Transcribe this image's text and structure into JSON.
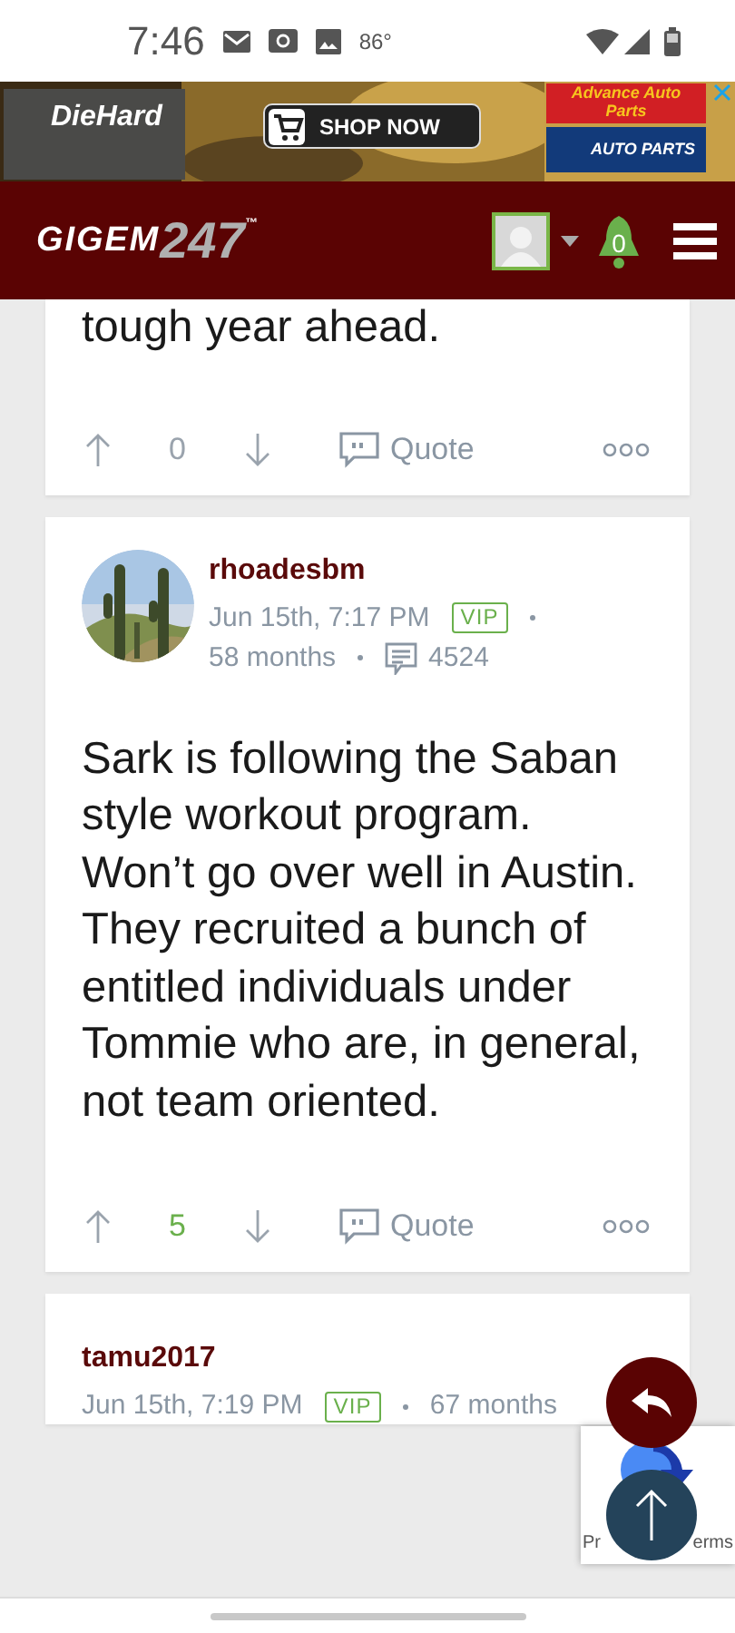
{
  "status_bar": {
    "time": "7:46",
    "temperature": "86°"
  },
  "ad": {
    "brand": "DieHard",
    "cta": "SHOP NOW",
    "retailer": "Advance Auto Parts",
    "partner": "AUTO PARTS"
  },
  "header": {
    "logo_main": "GIGEM",
    "logo_number": "247",
    "logo_mark": "™",
    "notifications": "0"
  },
  "posts": [
    {
      "body": "tough year ahead.",
      "votes": "0",
      "voted": false,
      "quote": "Quote"
    },
    {
      "author": "rhoadesbm",
      "avatar": true,
      "date": "Jun 15th, 7:17 PM",
      "badge": "VIP",
      "tenure": "58 months",
      "post_count": "4524",
      "body": "Sark is following the Saban style workout program. Won’t go over well in Austin. They recruited a bunch of entitled individuals under Tommie who are, in general, not team oriented.",
      "votes": "5",
      "voted": true,
      "quote": "Quote"
    },
    {
      "author": "tamu2017",
      "avatar": false,
      "date": "Jun 15th, 7:19 PM",
      "badge": "VIP",
      "tenure": "67 months"
    }
  ],
  "recaptcha": {
    "left": "Pr",
    "right": "erms"
  }
}
